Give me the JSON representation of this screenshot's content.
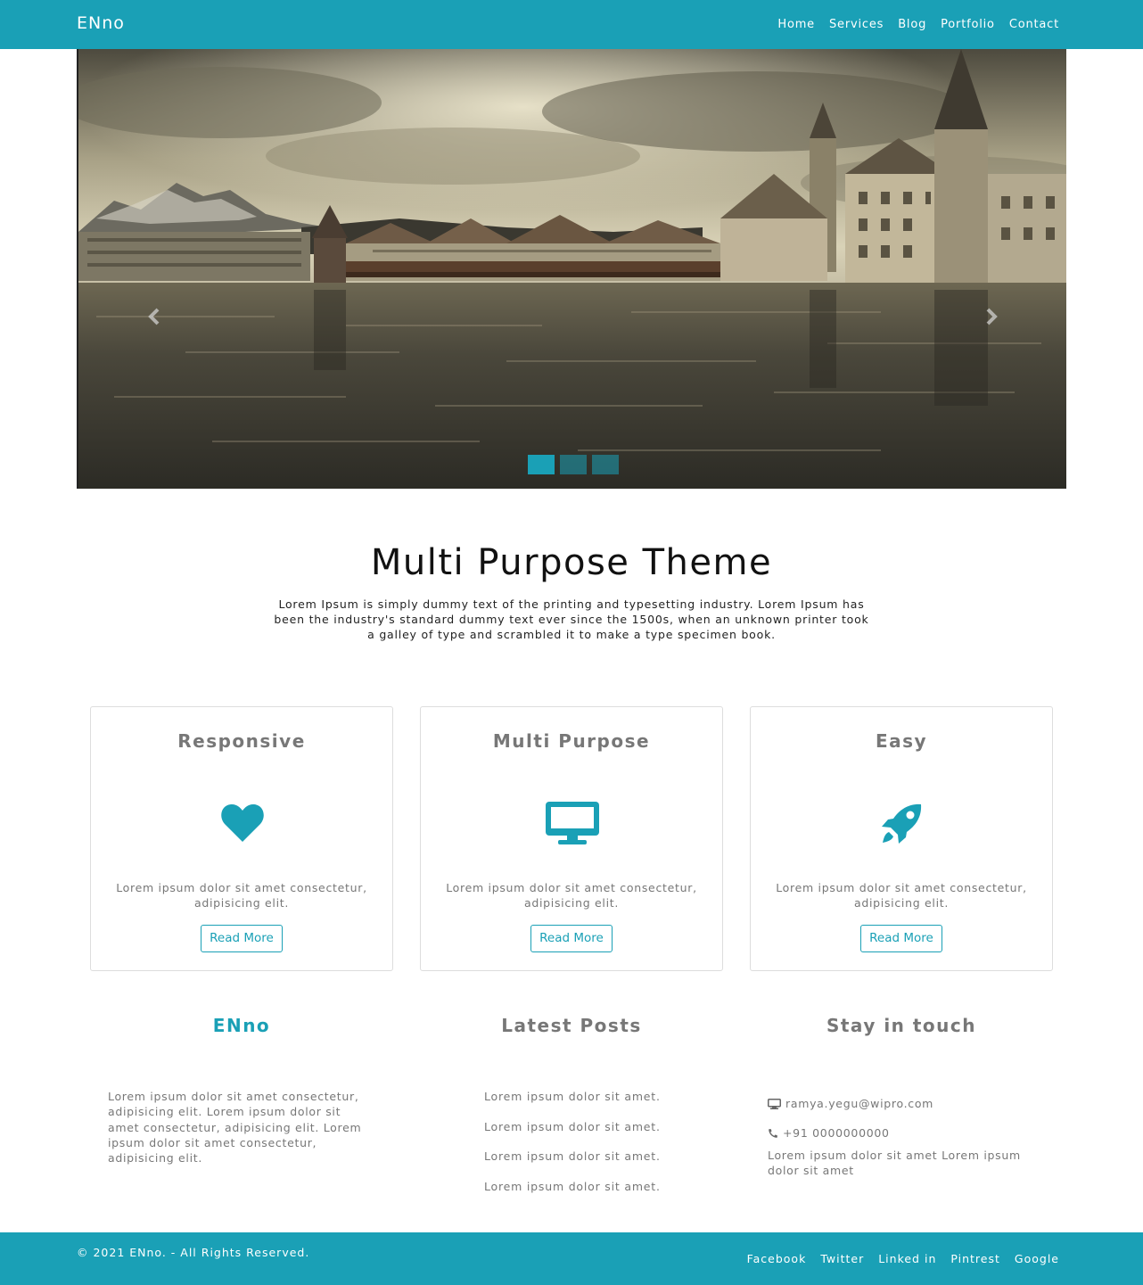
{
  "navbar": {
    "brand": "ENno",
    "links": [
      "Home",
      "Services",
      "Blog",
      "Portfolio",
      "Contact"
    ]
  },
  "carousel": {
    "image": "lakeside-city-panorama",
    "slide_count": 3,
    "active_slide": 1,
    "prev_icon": "chevron-left-icon",
    "next_icon": "chevron-right-icon"
  },
  "hero": {
    "title": "Multi Purpose Theme",
    "text": "Lorem Ipsum is simply dummy text of the printing and typesetting industry. Lorem Ipsum has been the industry's standard dummy text ever since the 1500s, when an unknown printer took a galley of type and scrambled it to make a type specimen book."
  },
  "features": [
    {
      "title": "Responsive",
      "icon": "heart-icon",
      "text": "Lorem ipsum dolor sit amet consectetur, adipisicing elit.",
      "button": "Read More"
    },
    {
      "title": "Multi Purpose",
      "icon": "desktop-icon",
      "text": "Lorem ipsum dolor sit amet consectetur, adipisicing elit.",
      "button": "Read More"
    },
    {
      "title": "Easy",
      "icon": "rocket-icon",
      "text": "Lorem ipsum dolor sit amet consectetur, adipisicing elit.",
      "button": "Read More"
    }
  ],
  "about": {
    "title": "ENno",
    "text": "Lorem ipsum dolor sit amet consectetur, adipisicing elit. Lorem ipsum dolor sit amet consectetur, adipisicing elit. Lorem ipsum dolor sit amet consectetur, adipisicing elit."
  },
  "latest_posts": {
    "title": "Latest Posts",
    "items": [
      "Lorem ipsum dolor sit amet.",
      "Lorem ipsum dolor sit amet.",
      "Lorem ipsum dolor sit amet.",
      "Lorem ipsum dolor sit amet."
    ]
  },
  "contact": {
    "title": "Stay in touch",
    "email": "ramya.yegu@wipro.com",
    "email_icon": "desktop-icon",
    "phone": "+91 0000000000",
    "phone_icon": "phone-icon",
    "text": "Lorem ipsum dolor sit amet Lorem ipsum dolor sit amet"
  },
  "footer": {
    "copyright": "© 2021 ENno. - All Rights Reserved.",
    "social": [
      "Facebook",
      "Twitter",
      "Linked in",
      "Pintrest",
      "Google"
    ]
  },
  "colors": {
    "accent": "#1aa0b6",
    "muted_text": "#777777",
    "border": "#dddddd"
  }
}
